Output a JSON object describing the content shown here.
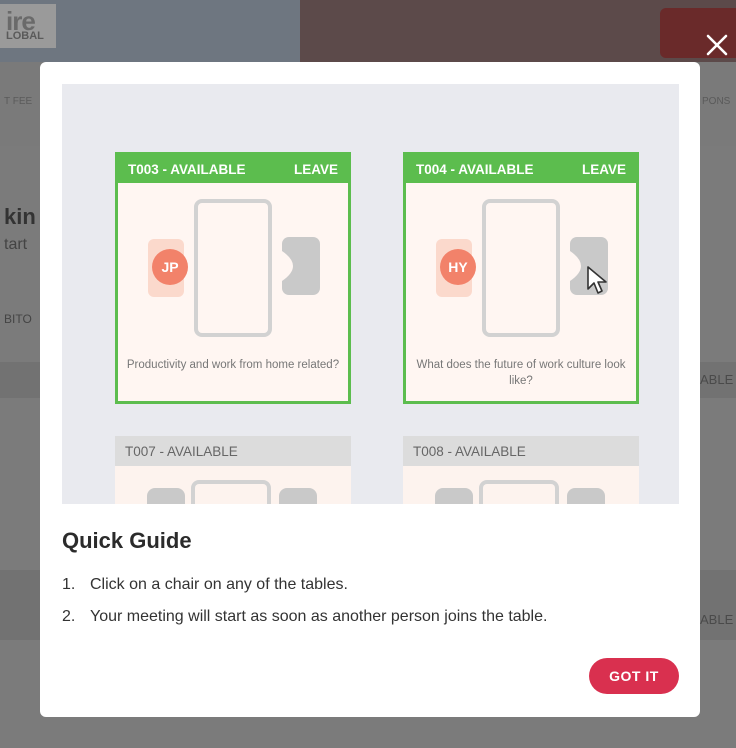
{
  "background": {
    "logo_big": "ire",
    "logo_small": "LOBAL",
    "nav_left_label": "T FEE",
    "nav_right_label": "PONS",
    "heading_fragment": "kin",
    "sub_fragment": "tart",
    "tab_fragment": "BITO",
    "row1_fragment": "ABLE",
    "row2_fragment": "ABLE"
  },
  "close_icon": "close-icon",
  "tables": [
    {
      "id_status": "T003 - AVAILABLE",
      "action": "LEAVE",
      "initials": "JP",
      "topic": "Productivity and work from home related?"
    },
    {
      "id_status": "T004 - AVAILABLE",
      "action": "LEAVE",
      "initials": "HY",
      "topic": "What does the future of work culture look like?"
    },
    {
      "id_status": "T007 - AVAILABLE"
    },
    {
      "id_status": "T008 - AVAILABLE"
    }
  ],
  "guide": {
    "title": "Quick Guide",
    "steps": [
      {
        "num": "1.",
        "text": "Click on a chair on any of the tables."
      },
      {
        "num": "2.",
        "text": "Your meeting will start as soon as another person joins the table."
      }
    ],
    "button_label": "GOT IT"
  },
  "colors": {
    "available_green": "#5cbd4e",
    "avatar_orange": "#f2826a",
    "button_red": "#d9304f"
  }
}
